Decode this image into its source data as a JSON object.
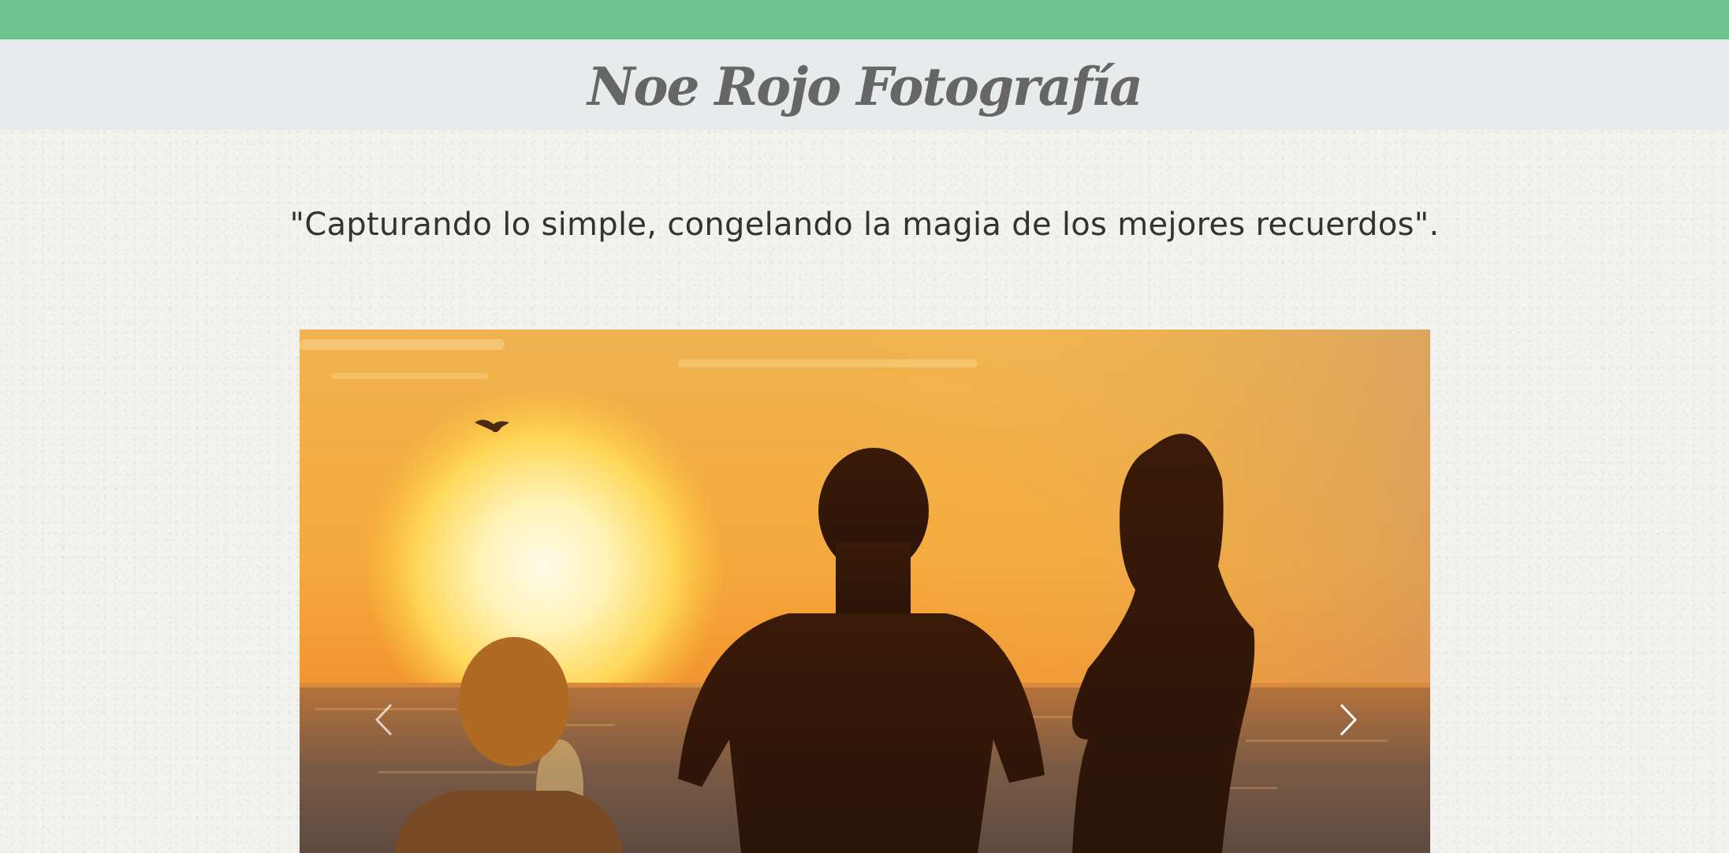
{
  "header": {
    "site_title": "Noe Rojo Fotografía",
    "top_bar_color": "#6dc58d"
  },
  "intro": {
    "tagline": "\"Capturando lo simple, congelando la magia de los mejores recuerdos\"."
  },
  "carousel": {
    "prev_icon": "chevron-left-icon",
    "next_icon": "chevron-right-icon",
    "slide_subject": "family-silhouettes-at-sunset"
  },
  "colors": {
    "accent": "#6dc58d",
    "header_bg": "#e8ebeb",
    "title": "#666666",
    "text": "#333333"
  }
}
